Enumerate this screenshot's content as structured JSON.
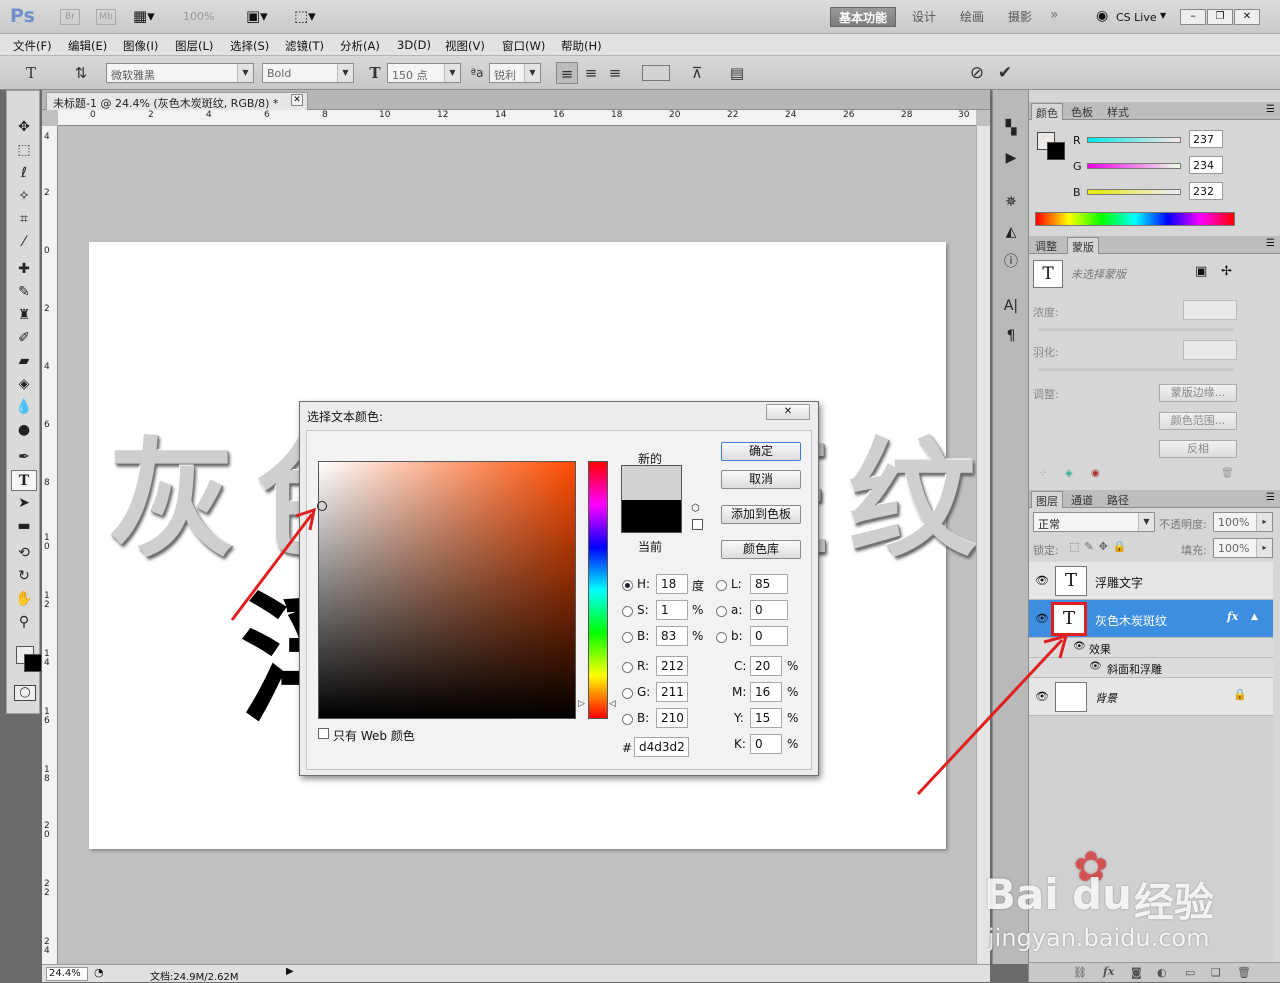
{
  "app": {
    "logo": "Ps",
    "logo_color": "#6e8ecc",
    "br": "Br",
    "mb": "Mb",
    "zoom": "100%"
  },
  "workspace": {
    "active": "基本功能",
    "items": [
      "设计",
      "绘画",
      "摄影"
    ],
    "cs_live": "CS Live"
  },
  "menu": [
    "文件(F)",
    "编辑(E)",
    "图像(I)",
    "图层(L)",
    "选择(S)",
    "滤镜(T)",
    "分析(A)",
    "3D(D)",
    "视图(V)",
    "窗口(W)",
    "帮助(H)"
  ],
  "options": {
    "font_family": "微软雅黑",
    "font_style": "Bold",
    "font_size": "150 点",
    "antialias": "锐利"
  },
  "document": {
    "tab_title": "未标题-1 @ 24.4% (灰色木炭斑纹, RGB/8) *",
    "text_line1": "灰色木炭斑纹",
    "text_line2": "浮"
  },
  "ruler": {
    "h": [
      "0",
      "2",
      "4",
      "6",
      "8",
      "10",
      "12",
      "14",
      "16",
      "18",
      "20",
      "22",
      "24",
      "26",
      "28",
      "30"
    ],
    "v": [
      "4",
      "2",
      "0",
      "2",
      "4",
      "6",
      "8",
      "1\n0",
      "1\n2",
      "1\n4",
      "1\n6",
      "1\n8",
      "2\n0",
      "2\n2",
      "2\n4"
    ]
  },
  "status": {
    "zoom": "24.4%",
    "doc_size": "文档:24.9M/2.62M"
  },
  "color_panel": {
    "tabs": [
      "颜色",
      "色板",
      "样式"
    ],
    "r_label": "R",
    "g_label": "G",
    "b_label": "B",
    "r": "237",
    "g": "234",
    "b": "232"
  },
  "masks_panel": {
    "tabs": [
      "调整",
      "蒙版"
    ],
    "no_mask": "未选择蒙版",
    "density": "浓度:",
    "feather": "羽化:",
    "adjust": "调整:",
    "mask_edge": "蒙版边缘...",
    "color_range": "颜色范围...",
    "invert": "反相"
  },
  "layers_panel": {
    "tabs": [
      "图层",
      "通道",
      "路径"
    ],
    "blend": "正常",
    "opacity_label": "不透明度:",
    "opacity": "100%",
    "lock_label": "锁定:",
    "fill_label": "填充:",
    "fill": "100%",
    "layers": [
      {
        "name": "浮雕文字",
        "thumb": "T"
      },
      {
        "name": "灰色木炭斑纹",
        "thumb": "T",
        "fx": "fx",
        "effects_label": "效果",
        "effect": "斜面和浮雕"
      },
      {
        "name": "背景"
      }
    ]
  },
  "dialog": {
    "title": "选择文本颜色:",
    "new_label": "新的",
    "current_label": "当前",
    "ok": "确定",
    "cancel": "取消",
    "add_swatch": "添加到色板",
    "color_lib": "颜色库",
    "web_only": "只有 Web 颜色",
    "h_label": "H:",
    "h": "18",
    "h_unit": "度",
    "s_label": "S:",
    "s": "1",
    "s_unit": "%",
    "b_label": "B:",
    "b": "83",
    "b_unit": "%",
    "r_label": "R:",
    "r": "212",
    "g_label": "G:",
    "g": "211",
    "bb_label": "B:",
    "bb": "210",
    "l_label": "L:",
    "l": "85",
    "a_label": "a:",
    "a": "0",
    "lb_label": "b:",
    "lb": "0",
    "c_label": "C:",
    "c": "20",
    "m_label": "M:",
    "m": "16",
    "y_label": "Y:",
    "y": "15",
    "k_label": "K:",
    "k": "0",
    "pct": "%",
    "hash": "#",
    "hex": "d4d3d2",
    "new_color": "#d4d3d2",
    "current_color": "#000000",
    "close": "✕"
  },
  "watermark": {
    "brand_a": "Bai",
    "brand_b": "du",
    "brand_cn": "经验",
    "url": "jingyan.baidu.com"
  },
  "colors": {
    "highlight": "#3d8de0",
    "arrow": "#e02020"
  }
}
